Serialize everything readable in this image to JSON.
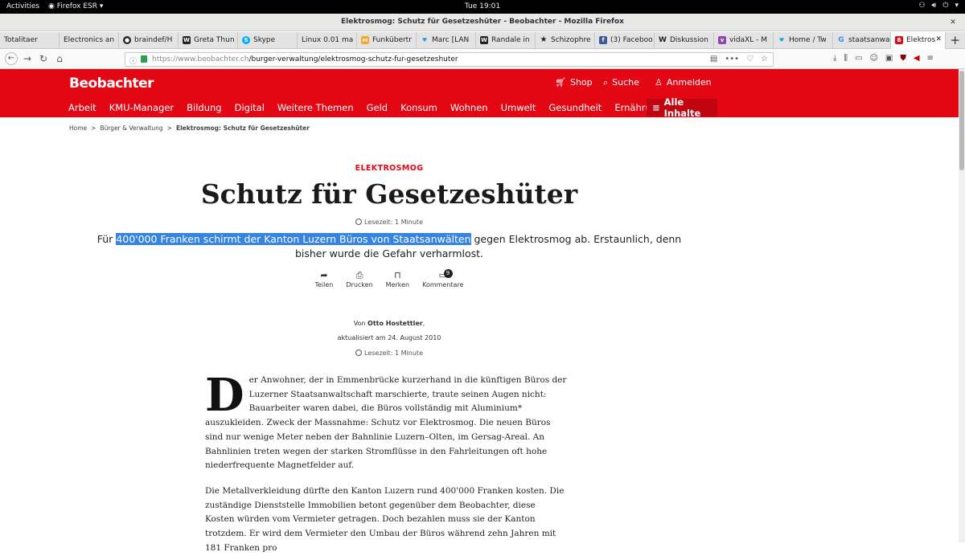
{
  "desktop": {
    "activities": "Activities",
    "app_menu": "Firefox ESR",
    "clock": "Tue 19:01"
  },
  "window": {
    "title": "Elektrosmog: Schutz für Gesetzeshüter - Beobachter - Mozilla Firefox"
  },
  "tabs": [
    {
      "label": "Totalitaer",
      "icon": "none"
    },
    {
      "label": "Electronics an",
      "icon": "none"
    },
    {
      "label": "braindef/H",
      "icon": "github-icon"
    },
    {
      "label": "Greta Thun",
      "icon": "wikipedia-icon"
    },
    {
      "label": "Skype",
      "icon": "skype-icon"
    },
    {
      "label": "Linux 0.01 ma",
      "icon": "none"
    },
    {
      "label": "Funkübertr",
      "icon": "bookmark-icon"
    },
    {
      "label": "Marc [LAN",
      "icon": "twitter-icon"
    },
    {
      "label": "Randale in",
      "icon": "wikipedia-icon"
    },
    {
      "label": "Schizophre",
      "icon": "star-icon"
    },
    {
      "label": "(3) Faceboo",
      "icon": "facebook-icon"
    },
    {
      "label": "Diskussion",
      "icon": "wikipedia-icon"
    },
    {
      "label": "vidaXL - M",
      "icon": "vidaxl-icon"
    },
    {
      "label": "Home / Tw",
      "icon": "twitter-icon"
    },
    {
      "label": "staatsanwa",
      "icon": "google-icon"
    },
    {
      "label": "Elektros",
      "icon": "beobachter-icon",
      "active": true
    }
  ],
  "navbar": {
    "url_host": "https://www.beobachter.ch",
    "url_path": "/burger-verwaltung/elektrosmog-schutz-fur-gesetzeshuter"
  },
  "site": {
    "logo": "Beobachter",
    "shop": "Shop",
    "search": "Suche",
    "login": "Anmelden",
    "categories": [
      "Arbeit",
      "KMU-Manager",
      "Bildung",
      "Digital",
      "Weitere Themen",
      "Geld",
      "Konsum",
      "Wohnen",
      "Umwelt",
      "Gesundheit",
      "Ernährung"
    ],
    "all_content": "Alle Inhalte"
  },
  "breadcrumb": {
    "home": "Home",
    "section": "Bürger & Verwaltung",
    "current": "Elektrosmog: Schutz für Gesetzeshüter",
    "separator": ">"
  },
  "article": {
    "kicker": "ELEKTROSMOG",
    "title": "Schutz für Gesetzeshüter",
    "reading_time": "Lesezeit: 1 Minute",
    "lead_prefix": "Für ",
    "lead_selected": "400'000 Franken schirmt der Kanton Luzern Büros von Staatsanwälten",
    "lead_suffix": " gegen Elektrosmog ab. Erstaunlich, denn bisher wurde die Gefahr verharmlost.",
    "actions": {
      "share": "Teilen",
      "print": "Drucken",
      "bookmark": "Merken",
      "comments": "Kommentare",
      "comment_count": "9"
    },
    "by_prefix": "Von ",
    "author": "Otto Hostettler",
    "by_suffix": ",",
    "updated": "aktualisiert am 24. August 2010",
    "dropcap": "D",
    "paragraph1": "er Anwohner, der in Emmenbrücke kurzerhand in die künftigen Büros der Luzerner Staatsanwaltschaft marschierte, traute seinen Augen nicht: Bauarbeiter waren dabei, die Büros vollständig mit Aluminium* auszukleiden. Zweck der Massnahme: Schutz vor Elektrosmog. Die neuen Büros sind nur wenige Meter neben der Bahnlinie Luzern–Olten, im Gersag-Areal. An Bahnlinien treten wegen der starken Stromflüsse in den Fahrleitungen oft hohe niederfrequente Magnetfelder auf.",
    "paragraph2": "Die Metallverkleidung dürfte den Kanton Luzern rund 400'000 Franken kosten. Die zuständige Dienststelle Immobilien betont gegenüber dem Beobachter, diese Kosten würden vom Vermieter getragen. Doch bezahlen muss sie der Kanton trotzdem. Er wird dem Vermieter den Umbau der Büros während zehn Jahren mit 181 Franken pro"
  },
  "colors": {
    "brand_red": "#e30613",
    "selection": "#3584e4"
  }
}
